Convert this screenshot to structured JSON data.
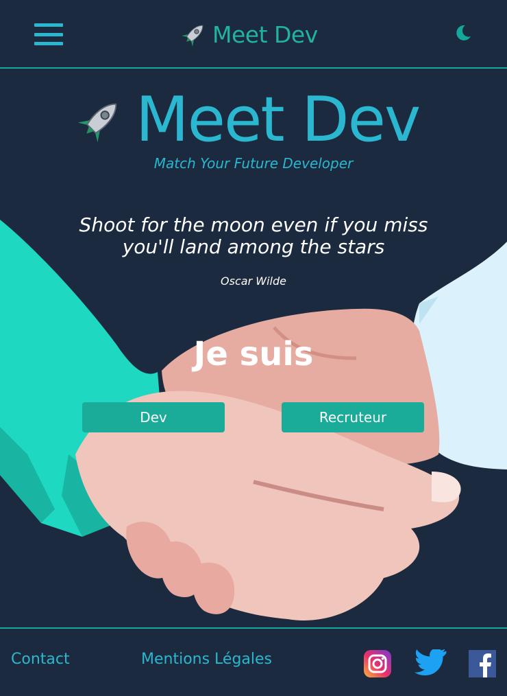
{
  "header": {
    "brand": "Meet Dev",
    "menu_icon": "hamburger-menu-icon",
    "theme_icon": "moon-icon"
  },
  "hero": {
    "title": "Meet Dev",
    "tagline": "Match Your Future Developer",
    "quote": "Shoot for the moon even if you miss you'll land among the stars",
    "author": "Oscar Wilde",
    "prompt": "Je suis",
    "buttons": {
      "dev": "Dev",
      "recruiter": "Recruteur"
    }
  },
  "footer": {
    "contact": "Contact",
    "legal": "Mentions Légales",
    "social": [
      "instagram-icon",
      "twitter-icon",
      "facebook-icon"
    ]
  },
  "colors": {
    "background": "#1b2a3e",
    "accent_teal": "#1aab99",
    "accent_blue": "#2bb7cf",
    "text": "#ffffff"
  }
}
